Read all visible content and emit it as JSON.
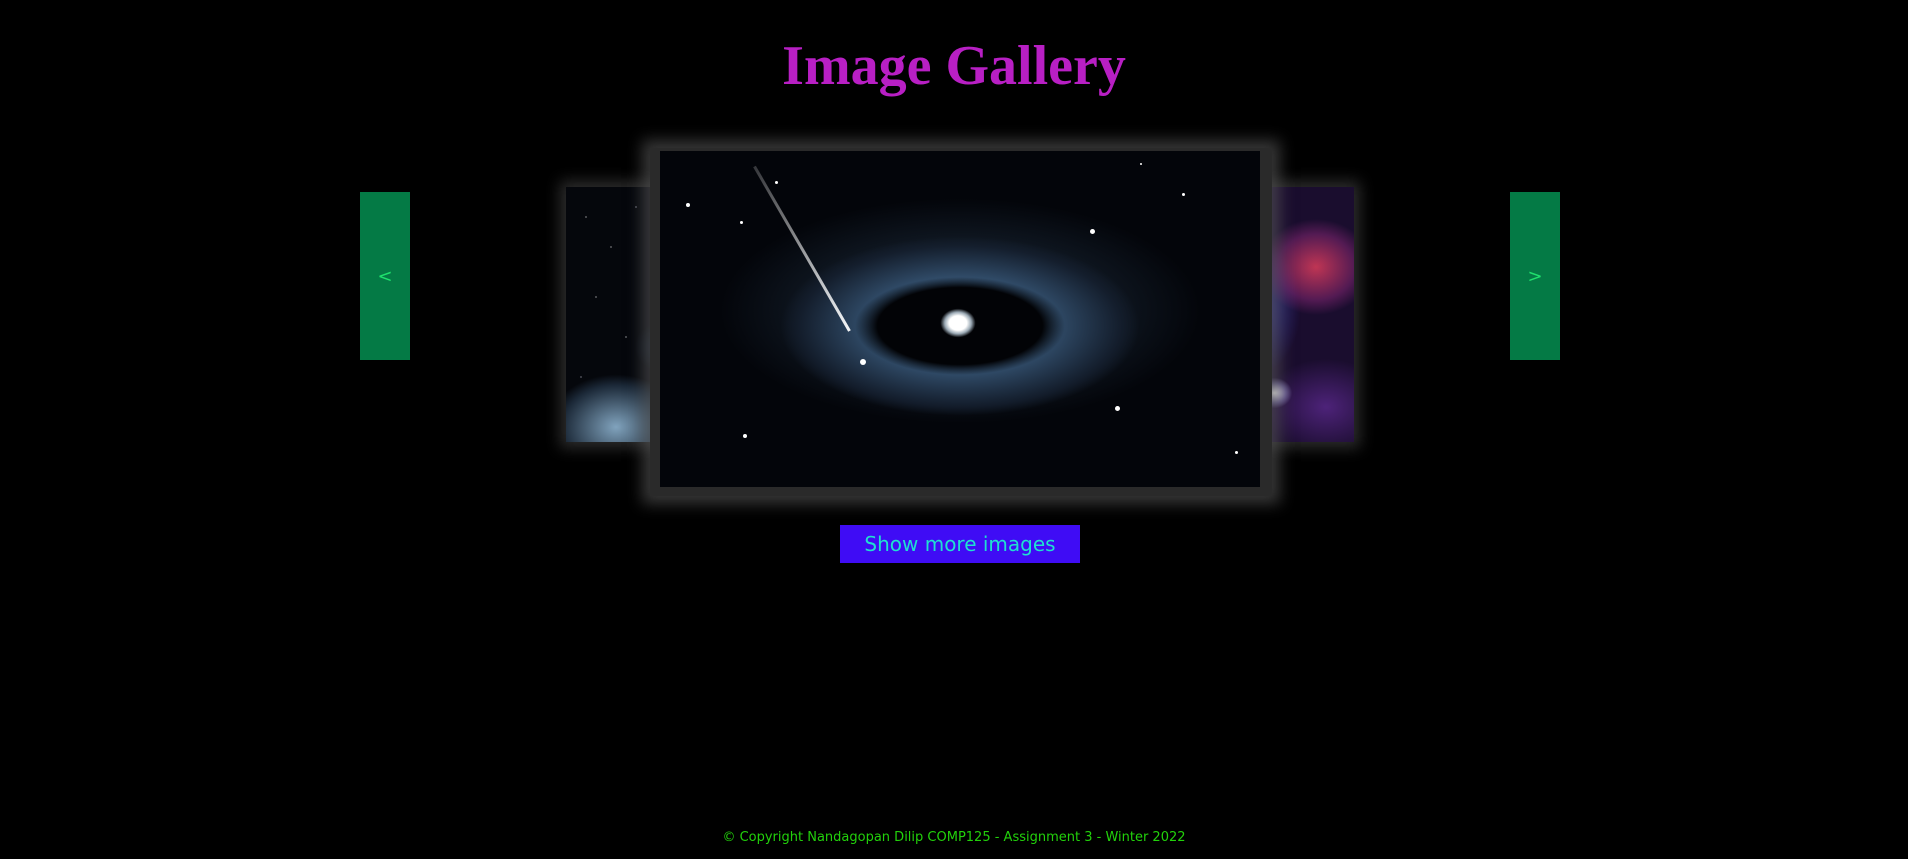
{
  "header": {
    "title": "Image Gallery"
  },
  "carousel": {
    "prev_label": "<",
    "next_label": ">"
  },
  "actions": {
    "show_more_label": "Show more images"
  },
  "footer": {
    "copyright": "© Copyright Nandagopan Dilip COMP125 - Assignment 3 - Winter 2022"
  },
  "colors": {
    "background": "#000000",
    "title": "#b81fc4",
    "nav_button_bg": "#047a45",
    "nav_button_text": "#1fe06d",
    "show_more_bg": "#3f0cf5",
    "show_more_text": "#1fe0d0",
    "footer_text": "#22d10b"
  }
}
